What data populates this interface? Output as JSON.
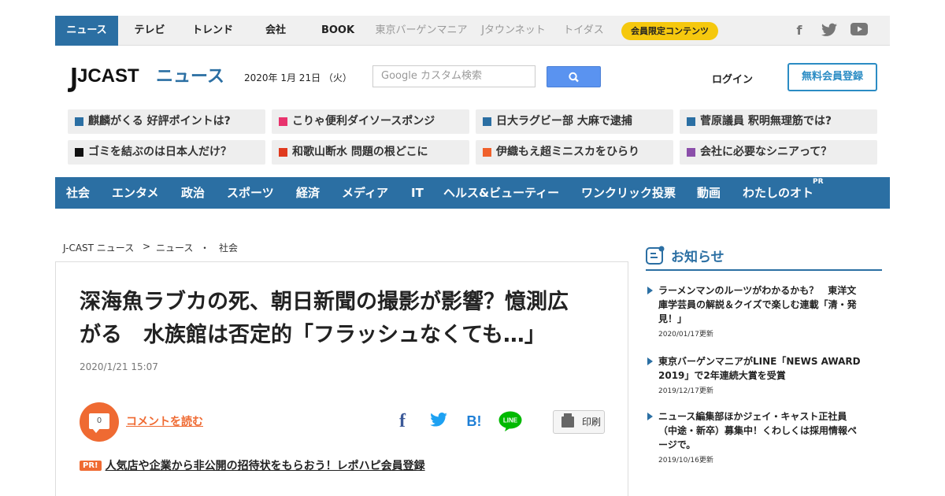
{
  "topnav": {
    "tabs": [
      "ニュース",
      "テレビ",
      "トレンド",
      "会社",
      "BOOK",
      "東京バーゲンマニア",
      "Jタウンネット",
      "トイダス"
    ],
    "member_label": "会員限定コンテンツ",
    "social": [
      "facebook-icon",
      "twitter-icon",
      "youtube-icon"
    ]
  },
  "header": {
    "logo_main": "JCAST",
    "logo_sub": "ニュース",
    "date": "2020年 1月 21日 （火）",
    "search_placeholder": "Google カスタム検索",
    "login": "ログイン",
    "register": "無料会員登録"
  },
  "trending": [
    {
      "text": "麒麟がくる 好評ポイントは?",
      "color": "#2b6fa3"
    },
    {
      "text": "こりゃ便利ダイソースポンジ",
      "color": "#e8336d"
    },
    {
      "text": "日大ラグビー部 大麻で逮捕",
      "color": "#2b6fa3"
    },
    {
      "text": "菅原議員 釈明無理筋では?",
      "color": "#2b6fa3"
    },
    {
      "text": "ゴミを結ぶのは日本人だけ？",
      "color": "#111111"
    },
    {
      "text": "和歌山断水 問題の根どこに",
      "color": "#e03a1e"
    },
    {
      "text": "伊織もえ超ミニスカをひらり",
      "color": "#f0612c"
    },
    {
      "text": "会社に必要なシニアって？",
      "color": "#8b4faa"
    }
  ],
  "categories": [
    "社会",
    "エンタメ",
    "政治",
    "スポーツ",
    "経済",
    "メディア",
    "IT",
    "ヘルス&ビューティー",
    "ワンクリック投票",
    "動画",
    "わたしのオト"
  ],
  "categories_pr": "PR",
  "breadcrumb": {
    "home": "J-CAST ニュース",
    "sep": ">",
    "section": "ニュース",
    "dot": "・",
    "current": "社会"
  },
  "article": {
    "title_line1": "深海魚ラブカの死、朝日新聞の撮影が影響？憶測広",
    "title_line2": "がる　水族館は否定的「フラッシュなくても…」",
    "date": "2020/1/21 15:07",
    "comment_count": "0",
    "comment_link": "コメントを読む",
    "share": {
      "fb": "f",
      "hatena": "B!",
      "line": "LINE"
    },
    "print": "印刷",
    "pr_tag": "PR!",
    "pr_text": "人気店や企業から非公開の招待状をもらおう！レポハピ会員登録"
  },
  "sidebar": {
    "title": "お知らせ",
    "items": [
      {
        "line1": "ラーメンマンのルーツがわかるかも？　東洋文",
        "line2": "庫学芸員の解説＆クイズで楽しむ連載「清・発",
        "line3": "見！」",
        "date": "2020/01/17更新"
      },
      {
        "line1": "東京バーゲンマニアがLINE「NEWS AWARD",
        "line2": "2019」で2年連続大賞を受賞",
        "line3": "",
        "date": "2019/12/17更新"
      },
      {
        "line1": "ニュース編集部ほかジェイ・キャスト正社員",
        "line2": "（中途・新卒）募集中！くわしくは採用情報ペ",
        "line3": "ージで。",
        "date": "2019/10/16更新"
      }
    ]
  },
  "colors": {
    "brand_blue": "#2b6fa3",
    "accent_orange": "#ef6a32",
    "member_yellow": "#f5c80e"
  }
}
